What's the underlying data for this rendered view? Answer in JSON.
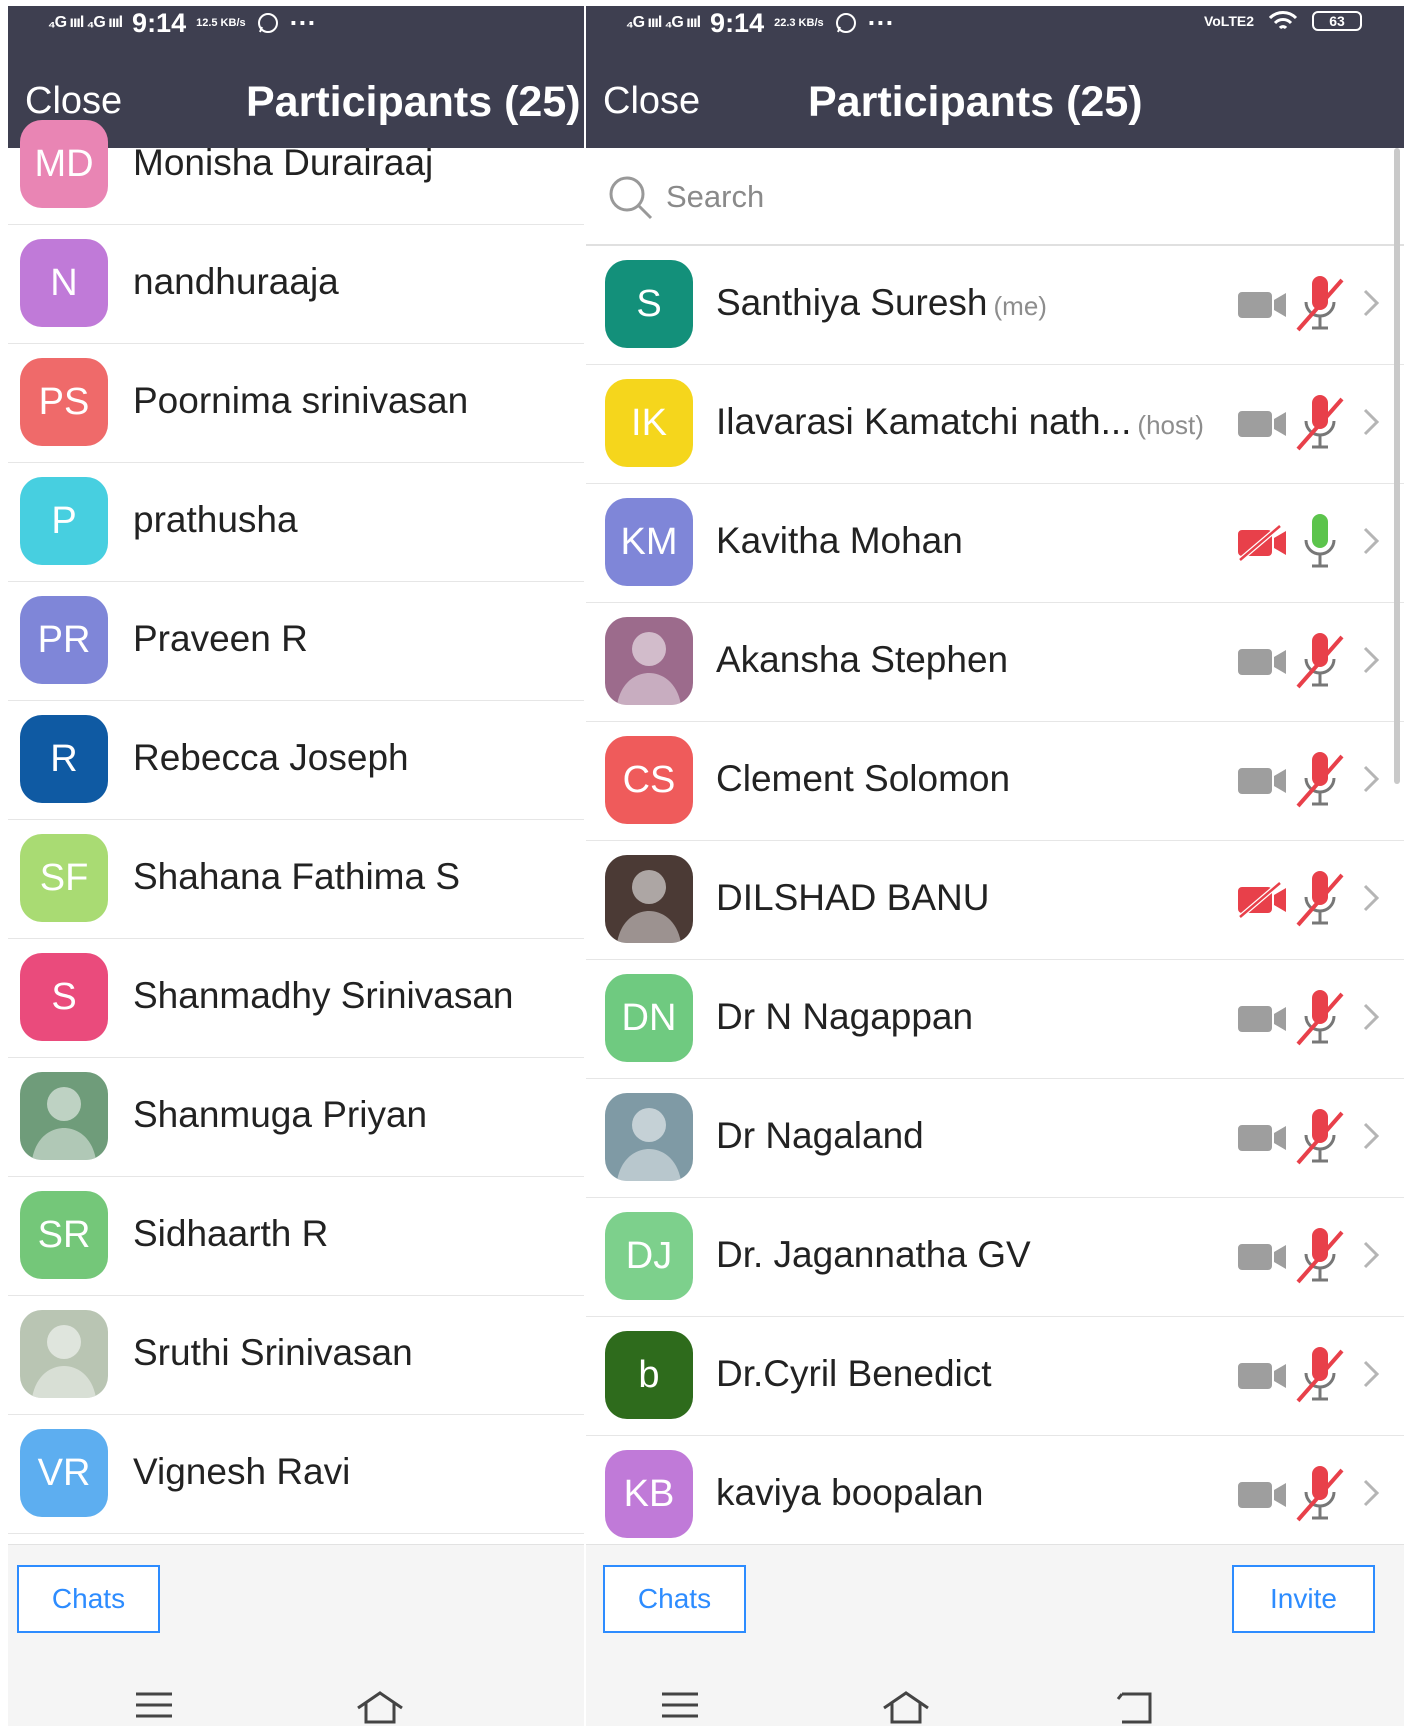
{
  "status_bar": {
    "time": "9:14",
    "signal": "₄G ıııl ₄G ıııl",
    "left_speed": "12.5 KB/s",
    "right_speed": "22.3 KB/s",
    "more": "···",
    "network": "VoLTE2",
    "battery": "63"
  },
  "left_panel": {
    "close_label": "Close",
    "title": "Participants (25)",
    "participants": [
      {
        "initials": "MD",
        "name": "Monisha Durairaaj",
        "color": "#e985b4"
      },
      {
        "initials": "N",
        "name": "nandhuraaja",
        "color": "#c07ad8"
      },
      {
        "initials": "PS",
        "name": "Poornima srinivasan",
        "color": "#ef6a6a"
      },
      {
        "initials": "P",
        "name": "prathusha",
        "color": "#47cfe0"
      },
      {
        "initials": "PR",
        "name": "Praveen R",
        "color": "#7f86d8"
      },
      {
        "initials": "R",
        "name": "Rebecca Joseph",
        "color": "#0f5aa3"
      },
      {
        "initials": "SF",
        "name": "Shahana Fathima S",
        "color": "#a9db73"
      },
      {
        "initials": "S",
        "name": "Shanmadhy Srinivasan",
        "color": "#ea4b7c"
      },
      {
        "initials": "",
        "name": "Shanmuga Priyan",
        "color": "#6f9c7a"
      },
      {
        "initials": "SR",
        "name": "Sidhaarth R",
        "color": "#74c779"
      },
      {
        "initials": "",
        "name": "Sruthi Srinivasan",
        "color": "#b9c5b3"
      },
      {
        "initials": "VR",
        "name": "Vignesh Ravi",
        "color": "#5daef0"
      }
    ],
    "chats_label": "Chats"
  },
  "right_panel": {
    "close_label": "Close",
    "title": "Participants (25)",
    "search_placeholder": "Search",
    "participants": [
      {
        "initials": "S",
        "name": "Santhiya Suresh",
        "tag": "(me)",
        "color": "#13907a",
        "video_off": false,
        "mic_on": false
      },
      {
        "initials": "IK",
        "name": "Ilavarasi Kamatchi nath...",
        "tag": "(host)",
        "color": "#f5d61c",
        "video_off": false,
        "mic_on": false
      },
      {
        "initials": "KM",
        "name": "Kavitha Mohan",
        "tag": "",
        "color": "#7f86d8",
        "video_off": true,
        "mic_on": true
      },
      {
        "initials": "",
        "name": "Akansha Stephen",
        "tag": "",
        "color": "#9c6b8c",
        "video_off": false,
        "mic_on": false
      },
      {
        "initials": "CS",
        "name": "Clement Solomon",
        "tag": "",
        "color": "#ef5b5b",
        "video_off": false,
        "mic_on": false
      },
      {
        "initials": "",
        "name": "DILSHAD BANU",
        "tag": "",
        "color": "#4b3a35",
        "video_off": true,
        "mic_on": false
      },
      {
        "initials": "DN",
        "name": "Dr N Nagappan",
        "tag": "",
        "color": "#6fca80",
        "video_off": false,
        "mic_on": false
      },
      {
        "initials": "",
        "name": "Dr Nagaland",
        "tag": "",
        "color": "#7f9aa5",
        "video_off": false,
        "mic_on": false
      },
      {
        "initials": "DJ",
        "name": "Dr. Jagannatha GV",
        "tag": "",
        "color": "#7dd08c",
        "video_off": false,
        "mic_on": false
      },
      {
        "initials": "b",
        "name": "Dr.Cyril Benedict",
        "tag": "",
        "color": "#2e6b1c",
        "video_off": false,
        "mic_on": false
      },
      {
        "initials": "KB",
        "name": "kaviya boopalan",
        "tag": "",
        "color": "#c07ad8",
        "video_off": false,
        "mic_on": false
      }
    ],
    "chats_label": "Chats",
    "invite_label": "Invite"
  },
  "colors": {
    "header": "#3e3f50",
    "accent": "#2d8cff",
    "muted_red": "#e8404a",
    "mic_green": "#5cc44c",
    "icon_gray": "#9e9e9e"
  }
}
